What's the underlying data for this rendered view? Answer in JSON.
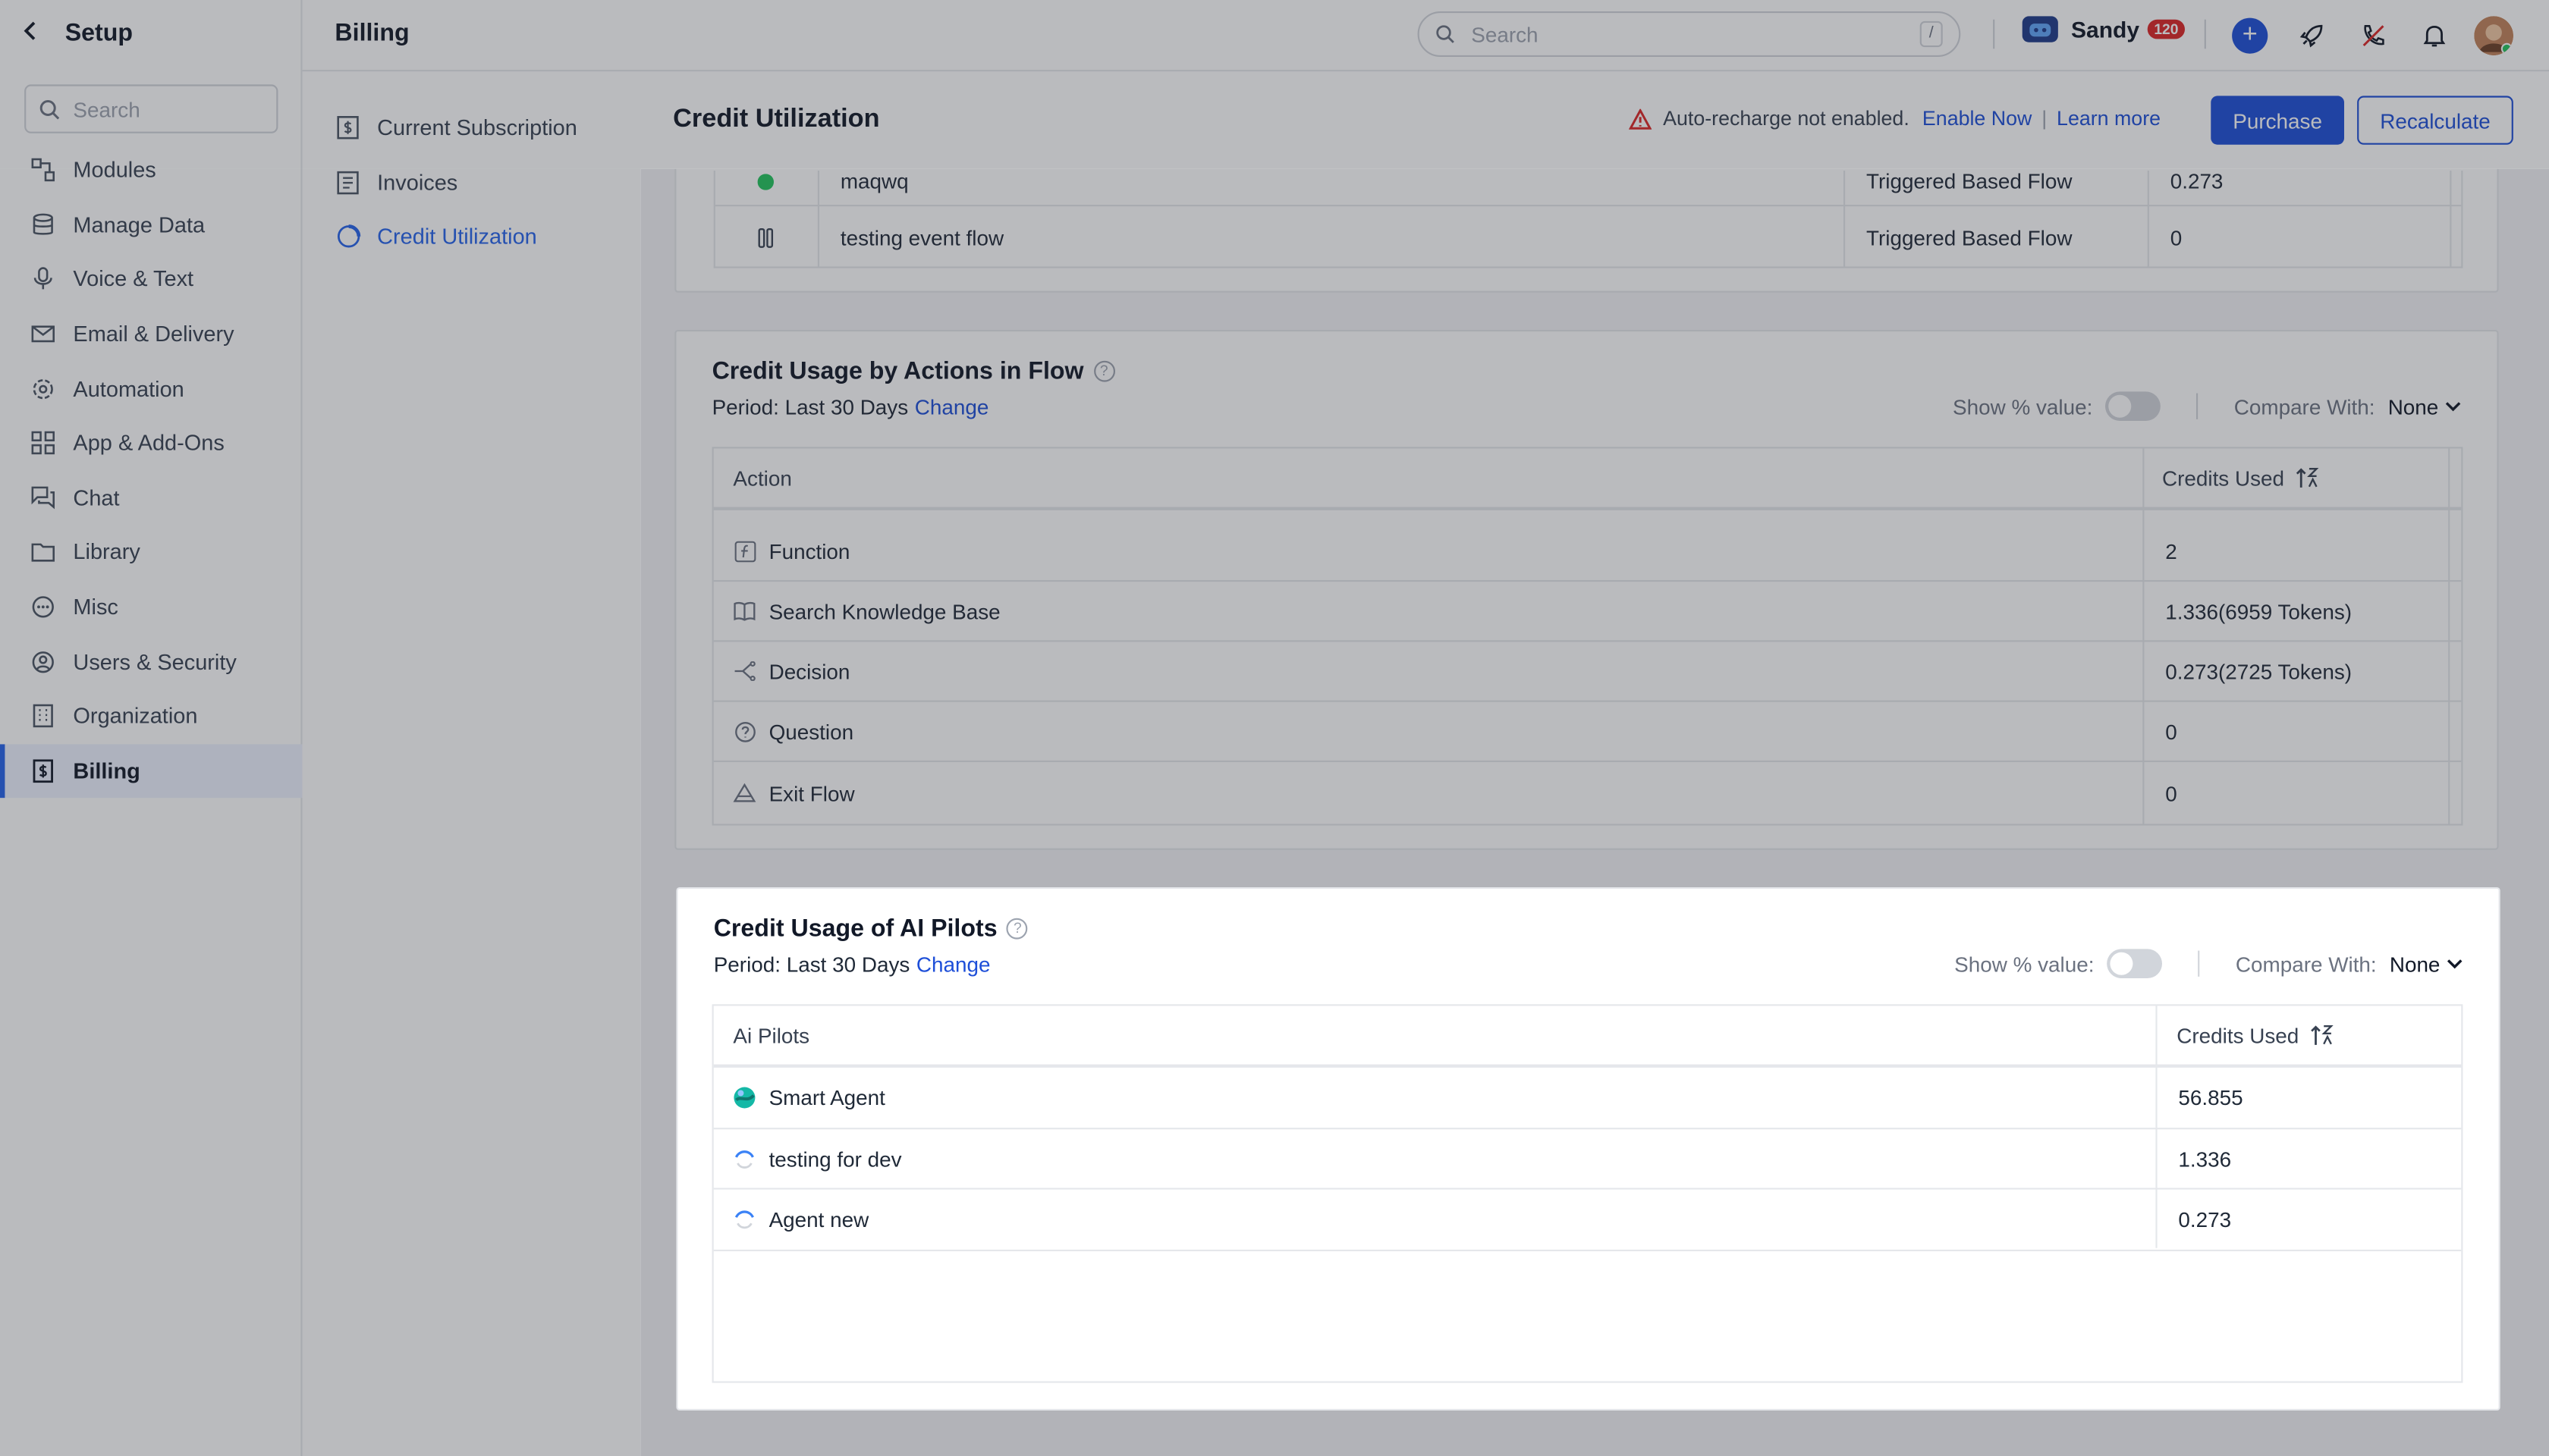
{
  "sidebar": {
    "title": "Setup",
    "search_placeholder": "Search",
    "items": [
      {
        "label": "Modules",
        "icon": "modules-icon"
      },
      {
        "label": "Manage Data",
        "icon": "database-icon"
      },
      {
        "label": "Voice & Text",
        "icon": "microphone-icon"
      },
      {
        "label": "Email & Delivery",
        "icon": "mail-icon"
      },
      {
        "label": "Automation",
        "icon": "automation-icon"
      },
      {
        "label": "App & Add-Ons",
        "icon": "grid-icon"
      },
      {
        "label": "Chat",
        "icon": "chat-icon"
      },
      {
        "label": "Library",
        "icon": "folder-icon"
      },
      {
        "label": "Misc",
        "icon": "dots-circle-icon"
      },
      {
        "label": "Users & Security",
        "icon": "user-circle-icon"
      },
      {
        "label": "Organization",
        "icon": "building-icon"
      },
      {
        "label": "Billing",
        "icon": "billing-icon"
      }
    ]
  },
  "subnav": {
    "items": [
      {
        "label": "Current Subscription",
        "icon": "subscription-icon"
      },
      {
        "label": "Invoices",
        "icon": "invoice-icon"
      },
      {
        "label": "Credit Utilization",
        "icon": "credit-icon"
      }
    ]
  },
  "topbar": {
    "title": "Billing",
    "search_placeholder": "Search",
    "search_shortcut": "/",
    "user_name": "Sandy",
    "user_badge": "120"
  },
  "content_header": {
    "title": "Credit Utilization",
    "alert_text": "Auto-recharge not enabled.",
    "enable_now": "Enable Now",
    "separator": "|",
    "learn_more": "Learn more",
    "purchase": "Purchase",
    "recalculate": "Recalculate"
  },
  "flows_table": {
    "rows": [
      {
        "name": "maqwq",
        "type": "Triggered Based Flow",
        "credits": "0.273"
      },
      {
        "name": "testing event flow",
        "type": "Triggered Based Flow",
        "credits": "0"
      }
    ]
  },
  "actions_card": {
    "title": "Credit Usage by Actions in Flow",
    "period_label": "Period: Last 30 Days",
    "change": "Change",
    "show_pct": "Show % value:",
    "compare_with": "Compare With:",
    "compare_value": "None",
    "col_action": "Action",
    "col_credits": "Credits Used",
    "rows": [
      {
        "action": "Function",
        "credits": "2",
        "icon": "function-icon"
      },
      {
        "action": "Search Knowledge Base",
        "credits": "1.336(6959 Tokens)",
        "icon": "book-icon"
      },
      {
        "action": "Decision",
        "credits": "0.273(2725 Tokens)",
        "icon": "decision-icon"
      },
      {
        "action": "Question",
        "credits": "0",
        "icon": "question-icon"
      },
      {
        "action": "Exit Flow",
        "credits": "0",
        "icon": "exit-icon"
      }
    ]
  },
  "pilots_card": {
    "title": "Credit Usage of AI Pilots",
    "period_label": "Period: Last 30 Days",
    "change": "Change",
    "show_pct": "Show % value:",
    "compare_with": "Compare With:",
    "compare_value": "None",
    "col_pilot": "Ai Pilots",
    "col_credits": "Credits Used",
    "rows": [
      {
        "name": "Smart Agent",
        "credits": "56.855"
      },
      {
        "name": "testing for dev",
        "credits": "1.336"
      },
      {
        "name": "Agent new",
        "credits": "0.273"
      }
    ]
  },
  "colors": {
    "accent": "#1d4ed8",
    "alert": "#dc2626"
  }
}
